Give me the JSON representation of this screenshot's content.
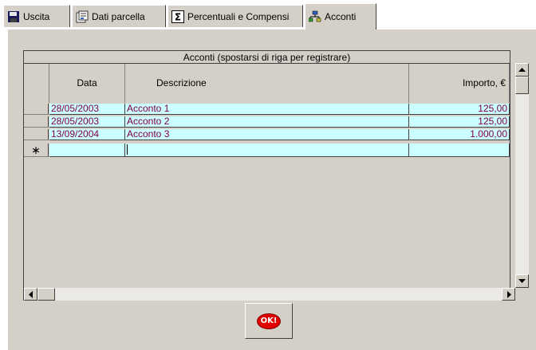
{
  "tabs": [
    {
      "label": "Uscita",
      "icon": "floppy-disk-icon",
      "active": false
    },
    {
      "label": "Dati parcella",
      "icon": "document-properties-icon",
      "active": false
    },
    {
      "label": "Percentuali e Compensi",
      "icon": "sigma-icon",
      "active": false
    },
    {
      "label": "Acconti",
      "icon": "network-icon",
      "active": true
    }
  ],
  "grid": {
    "caption": "Acconti (spostarsi di riga per registrare)",
    "columns": [
      "Data",
      "Descrizione",
      "Importo, €"
    ],
    "rows": [
      {
        "data": "28/05/2003",
        "descrizione": "Acconto 1",
        "importo": "125,00"
      },
      {
        "data": "28/05/2003",
        "descrizione": "Acconto 2",
        "importo": "125,00"
      },
      {
        "data": "13/09/2004",
        "descrizione": "Acconto 3",
        "importo": "1.000,00"
      }
    ],
    "new_row_marker": "∗"
  },
  "ok_button": {
    "label": "OK!"
  },
  "colors": {
    "row_bg": "#ccffff",
    "cell_text": "#800040",
    "ok_red": "#e00000"
  }
}
